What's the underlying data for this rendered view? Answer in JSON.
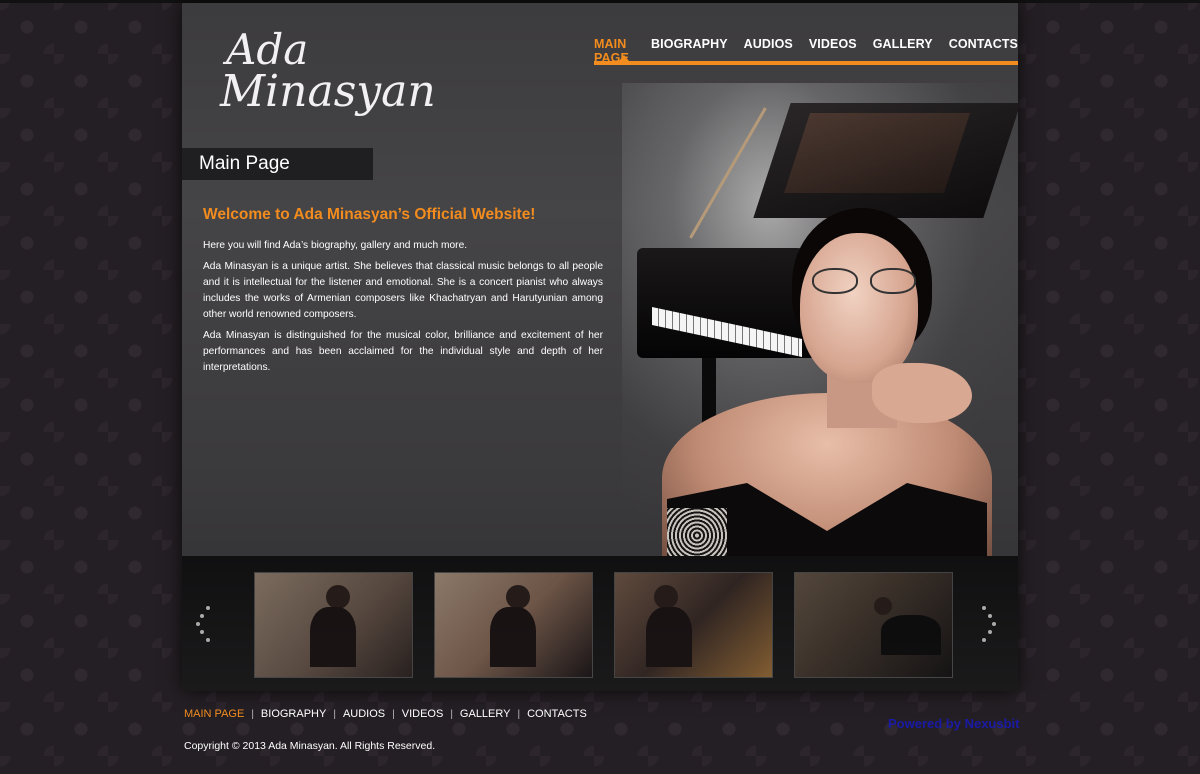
{
  "logo": {
    "line1": "Ada",
    "line2": "Minasyan"
  },
  "nav": [
    {
      "label": "MAIN PAGE",
      "active": true
    },
    {
      "label": "BIOGRAPHY",
      "active": false
    },
    {
      "label": "AUDIOS",
      "active": false
    },
    {
      "label": "VIDEOS",
      "active": false
    },
    {
      "label": "GALLERY",
      "active": false
    },
    {
      "label": "CONTACTS",
      "active": false
    }
  ],
  "page_title": "Main Page",
  "content": {
    "heading": "Welcome to Ada Minasyan’s Official Website!",
    "paragraphs": [
      "Here you will find Ada’s biography, gallery and much more.",
      "Ada Minasyan is a unique artist. She believes that classical music belongs to all people and it is intellectual for the listener and emotional. She is a concert pianist who always includes the works of Armenian composers like Khachatryan and Harutyunian among other world renowned composers.",
      "Ada Minasyan is distinguished for the musical color, brilliance and excitement of her performances and has been acclaimed for the individual style and depth of her interpretations."
    ]
  },
  "footer": {
    "nav": [
      "MAIN PAGE",
      "BIOGRAPHY",
      "AUDIOS",
      "VIDEOS",
      "GALLERY",
      "CONTACTS"
    ],
    "powered_by": "Powered by Nexusbit",
    "copyright": "Copyright © 2013 Ada Minasyan. All Rights Reserved."
  },
  "colors": {
    "accent": "#f28c1e",
    "powered_link": "#1a1aa6"
  }
}
